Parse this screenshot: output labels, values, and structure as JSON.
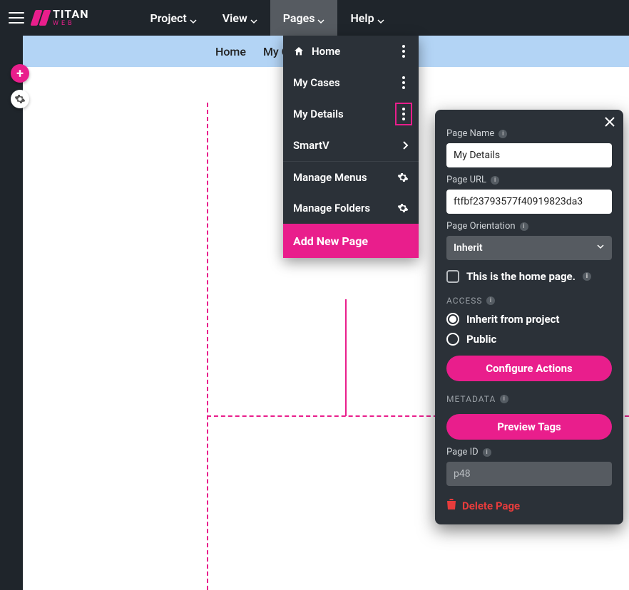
{
  "brand": {
    "name": "TITAN",
    "sub": "WEB"
  },
  "menubar": {
    "items": [
      "Project",
      "View",
      "Pages",
      "Help"
    ],
    "activeIndex": 2
  },
  "breadcrumbs": {
    "items": [
      "Home",
      "My C"
    ]
  },
  "pagesMenu": {
    "items": [
      {
        "label": "Home",
        "icon": "home",
        "trailing": "dots"
      },
      {
        "label": "My Cases",
        "trailing": "dots"
      },
      {
        "label": "My Details",
        "trailing": "dots",
        "selected": true
      },
      {
        "label": "SmartV",
        "trailing": "chevron"
      }
    ],
    "manage": [
      {
        "label": "Manage Menus",
        "trailing": "gear"
      },
      {
        "label": "Manage Folders",
        "trailing": "gear"
      }
    ],
    "addNew": "Add New Page"
  },
  "panel": {
    "labels": {
      "pageName": "Page Name",
      "pageUrl": "Page URL",
      "orientation": "Page Orientation",
      "homeCheck": "This is the home page.",
      "access": "ACCESS",
      "inherit": "Inherit from project",
      "public": "Public",
      "configure": "Configure Actions",
      "metadata": "METADATA",
      "preview": "Preview Tags",
      "pageId": "Page ID",
      "delete": "Delete Page"
    },
    "values": {
      "pageName": "My Details",
      "pageUrl": "ftfbf23793577f40919823da3",
      "orientation": "Inherit",
      "isHome": false,
      "access": "inherit",
      "pageId": "p48"
    }
  }
}
